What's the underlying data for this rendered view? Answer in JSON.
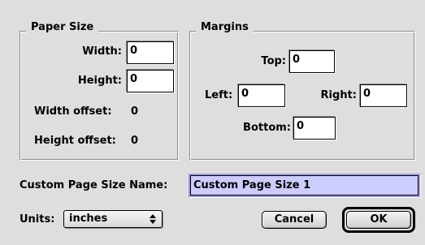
{
  "paper_size": {
    "title": "Paper Size",
    "width_label": "Width:",
    "width_value": "0",
    "height_label": "Height:",
    "height_value": "0",
    "width_offset_label": "Width offset:",
    "width_offset_value": "0",
    "height_offset_label": "Height offset:",
    "height_offset_value": "0"
  },
  "margins": {
    "title": "Margins",
    "top_label": "Top:",
    "top_value": "0",
    "left_label": "Left:",
    "left_value": "0",
    "right_label": "Right:",
    "right_value": "0",
    "bottom_label": "Bottom:",
    "bottom_value": "0"
  },
  "custom_name": {
    "label": "Custom Page Size Name:",
    "value": "Custom Page Size 1"
  },
  "units": {
    "label": "Units:",
    "selected": "inches"
  },
  "buttons": {
    "cancel": "Cancel",
    "ok": "OK"
  },
  "colors": {
    "dialog_bg": "#dedede",
    "focused_field_bg": "#ccccff"
  }
}
